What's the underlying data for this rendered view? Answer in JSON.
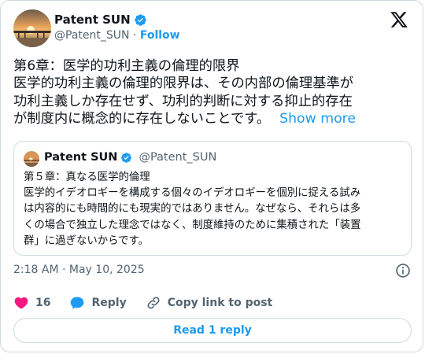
{
  "author": {
    "name": "Patent SUN",
    "handle": "@Patent_SUN",
    "separator": "·",
    "follow_label": "Follow"
  },
  "post": {
    "lines": [
      "第6章：医学的功利主義の倫理的限界",
      "医学的功利主義の倫理的限界は、その内部の倫理基準が",
      "功利主義しか存在せず、功利的判断に対する抑止的存在",
      "が制度内に概念的に存在しないことです。"
    ],
    "show_more": "Show more"
  },
  "quote": {
    "name": "Patent SUN",
    "handle": "@Patent_SUN",
    "lines": [
      "第５章：真なる医学的倫理",
      "医学的イデオロギーを構成する個々のイデオロギーを個別に捉える試み",
      "は内容的にも時間的にも現実的ではありません。なぜなら、それらは多",
      "くの場合で独立した理念ではなく、制度維持のために集積された「装置",
      "群」に過ぎないからです。"
    ]
  },
  "meta": {
    "timestamp": "2:18 AM · May 10, 2025"
  },
  "actions": {
    "like_count": "16",
    "reply_label": "Reply",
    "copy_link_label": "Copy link to post"
  },
  "read_reply_label": "Read 1 reply",
  "colors": {
    "accent": "#1d9bf0",
    "like": "#f91880",
    "verified": "#1d9bf0",
    "muted": "#536471",
    "border": "#cfd9de"
  }
}
